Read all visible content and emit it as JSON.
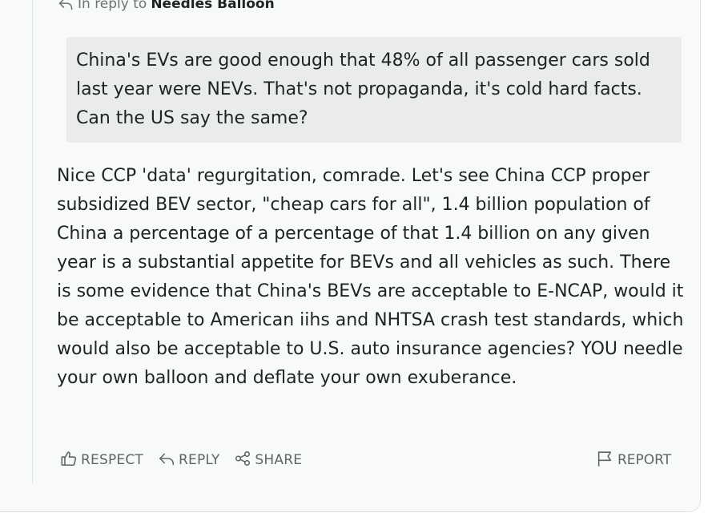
{
  "reply_header": {
    "prefix": "In reply to",
    "author": "Needles Balloon"
  },
  "quoted_comment": {
    "text": "China's EVs are good enough that 48% of all passenger cars sold last year were NEVs. That's not propaganda, it's cold hard facts. Can the US say the same?"
  },
  "comment": {
    "text": "Nice CCP 'data' regurgitation, comrade. Let's see China CCP proper subsidized BEV sector, \"cheap cars for all\", 1.4 billion population of China a percentage of a percentage of that 1.4 billion on any given year is a substantial appetite for BEVs and all vehicles as such. There is some evidence that China's BEVs are acceptable to E-NCAP, would it be acceptable to American iihs and NHTSA crash test standards, which would also be acceptable to U.S. auto insurance agencies? YOU needle your own balloon and deflate your own exuberance."
  },
  "actions": {
    "respect": {
      "label": "RESPECT",
      "icon": "thumbs-up-icon"
    },
    "reply": {
      "label": "REPLY",
      "icon": "reply-arrow-icon"
    },
    "share": {
      "label": "SHARE",
      "icon": "share-icon"
    },
    "report": {
      "label": "REPORT",
      "icon": "flag-icon"
    }
  },
  "colors": {
    "card_background": "#f8faf9",
    "quote_background": "#e9ecea",
    "text": "#1f2322",
    "muted_text": "#5d6663"
  }
}
